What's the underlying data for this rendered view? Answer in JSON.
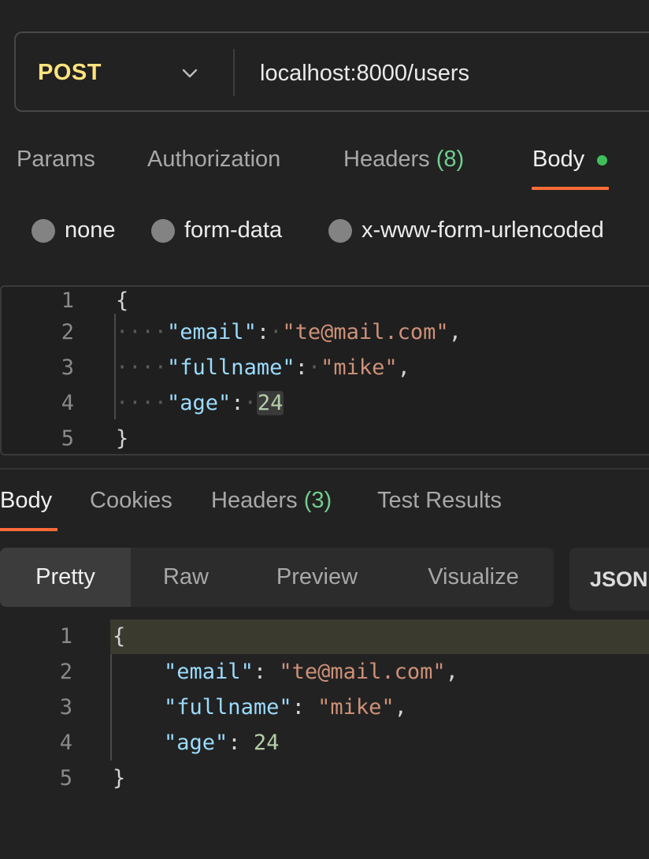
{
  "request": {
    "method": "POST",
    "url": "localhost:8000/users",
    "tabs": [
      {
        "label": "Params"
      },
      {
        "label": "Authorization"
      },
      {
        "label": "Headers",
        "count": "(8)"
      },
      {
        "label": "Body"
      }
    ],
    "body_modes": [
      "none",
      "form-data",
      "x-www-form-urlencoded"
    ],
    "body_lines": {
      "l1": {
        "num": "1",
        "open": "{"
      },
      "l2": {
        "num": "2",
        "key": "\"email\"",
        "value": "\"te@mail.com\""
      },
      "l3": {
        "num": "3",
        "key": "\"fullname\"",
        "value": "\"mike\""
      },
      "l4": {
        "num": "4",
        "key": "\"age\"",
        "value": "24"
      },
      "l5": {
        "num": "5",
        "close": "}"
      }
    }
  },
  "response": {
    "tabs": [
      {
        "label": "Body"
      },
      {
        "label": "Cookies"
      },
      {
        "label": "Headers",
        "count": "(3)"
      },
      {
        "label": "Test Results"
      }
    ],
    "views": [
      "Pretty",
      "Raw",
      "Preview",
      "Visualize"
    ],
    "format": "JSON",
    "body_lines": {
      "l1": {
        "num": "1",
        "open": "{"
      },
      "l2": {
        "num": "2",
        "key": "\"email\"",
        "value": "\"te@mail.com\""
      },
      "l3": {
        "num": "3",
        "key": "\"fullname\"",
        "value": "\"mike\""
      },
      "l4": {
        "num": "4",
        "key": "\"age\"",
        "value": "24"
      },
      "l5": {
        "num": "5",
        "close": "}"
      }
    }
  },
  "colors": {
    "accent": "#ff6c37",
    "method": "#ffe47e",
    "status_dot": "#3fbf5a"
  }
}
